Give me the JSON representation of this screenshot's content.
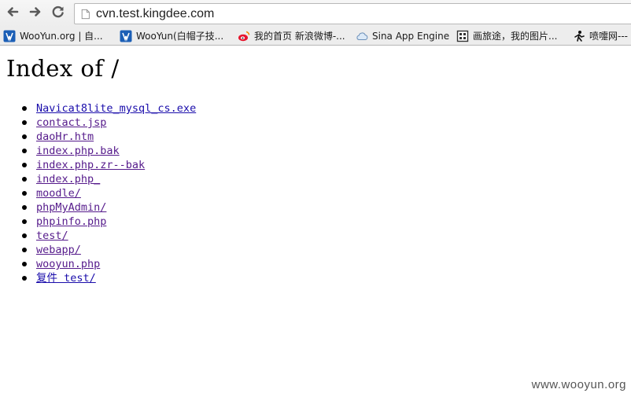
{
  "browser": {
    "back_icon": "arrow-left-icon",
    "forward_icon": "arrow-right-icon",
    "reload_icon": "reload-icon",
    "page_icon": "document-icon",
    "url": "cvn.test.kingdee.com"
  },
  "bookmarks": [
    {
      "icon": "wooyun-icon",
      "label": "WooYun.org | 自..."
    },
    {
      "icon": "wooyun-icon",
      "label": "WooYun(白帽子技..."
    },
    {
      "icon": "weibo-icon",
      "label": "我的首页 新浪微博-..."
    },
    {
      "icon": "cloud-icon",
      "label": "Sina App Engine"
    },
    {
      "icon": "grid-icon",
      "label": "画旅途，我的图片..."
    },
    {
      "icon": "figure-icon",
      "label": "喷嚏网---"
    }
  ],
  "page": {
    "title": "Index of /",
    "entries": [
      "Navicat8lite_mysql_cs.exe",
      "contact.jsp",
      "daoHr.htm",
      "index.php.bak",
      "index.php.zr--bak",
      "index.php_",
      "moodle/",
      "phpMyAdmin/",
      "phpinfo.php",
      "test/",
      "webapp/",
      "wooyun.php",
      "复件 test/"
    ]
  },
  "watermark": "www.wooyun.org",
  "colors": {
    "link": "#1a0dab",
    "visited_link": "#551a8b",
    "toolbar_bg": "#ededed"
  }
}
